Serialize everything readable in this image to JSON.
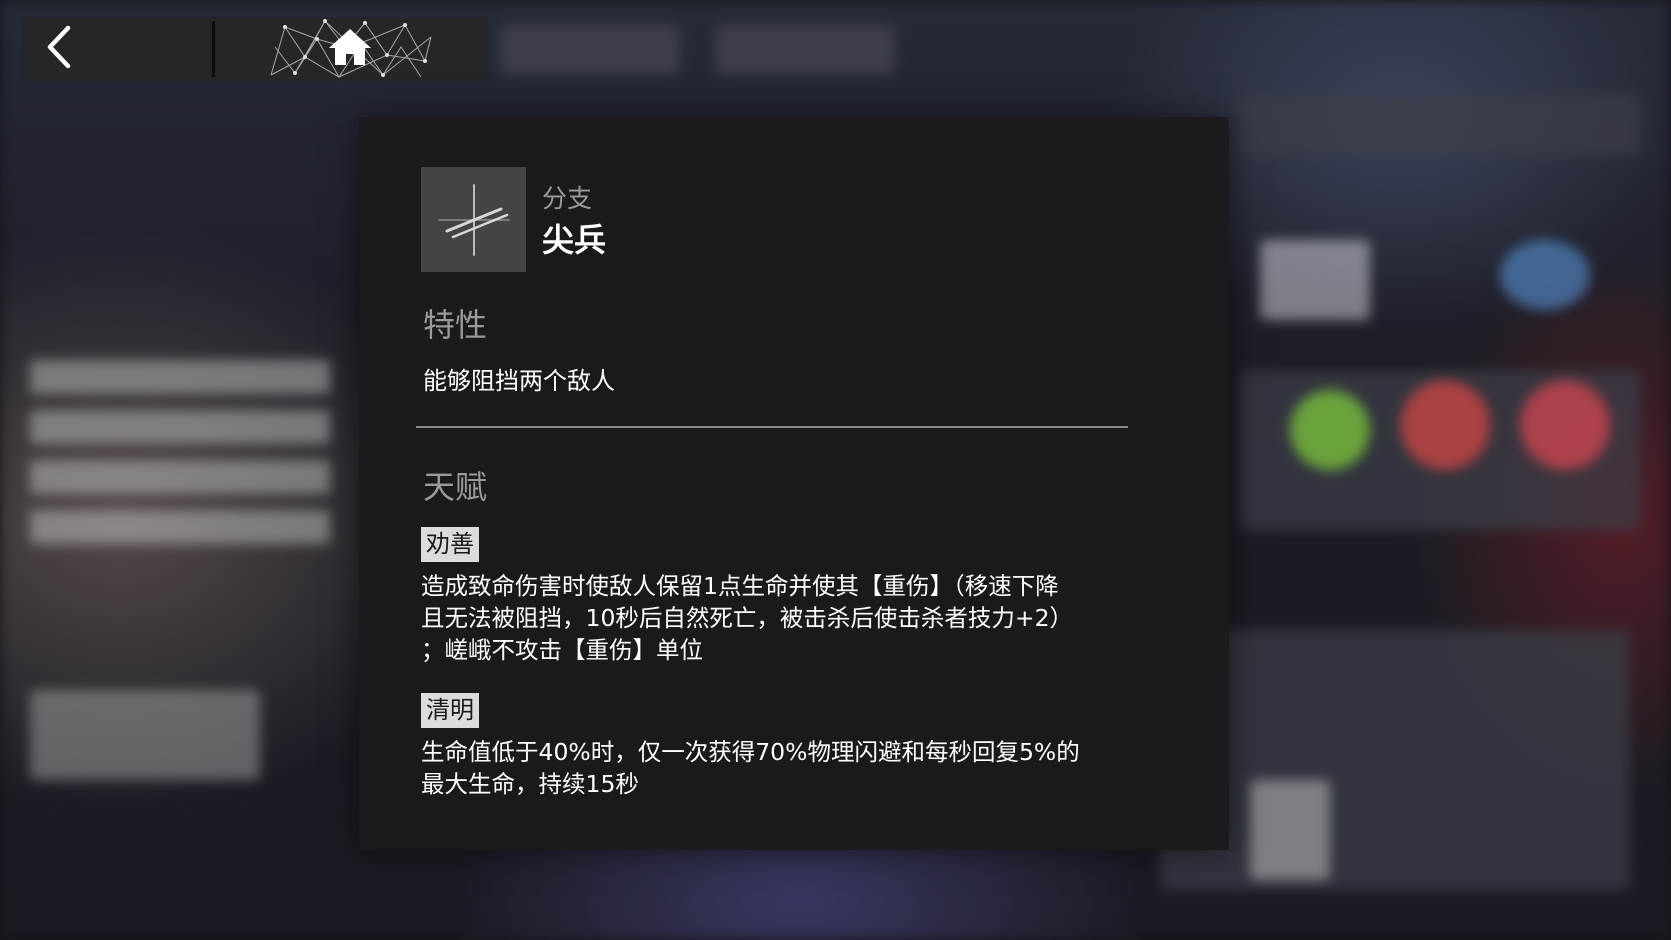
{
  "top_bar": {
    "back_icon": "chevron-left-icon",
    "home_icon": "home-icon"
  },
  "operator_info": {
    "branch_label": "分支",
    "branch_name": "尖兵",
    "branch_icon": "vanguard-branch-icon",
    "trait": {
      "title": "特性",
      "description": "能够阻挡两个敌人"
    },
    "talents": {
      "title": "天赋",
      "items": [
        {
          "name": "劝善",
          "description": "造成致命伤害时使敌人保留1点生命并使其【重伤】（移速下降\n且无法被阻挡，10秒后自然死亡，被击杀后使击杀者技力+2）\n；嵯峨不攻击【重伤】单位"
        },
        {
          "name": "清明",
          "description": "生命值低于40%时，仅一次获得70%物理闪避和每秒回复5%的\n最大生命，持续15秒"
        }
      ]
    }
  },
  "colors": {
    "panel_bg": "#1a1a1c",
    "tag_bg": "#dcdcdc",
    "muted_text": "#9a9a9a",
    "text": "#ffffff"
  }
}
